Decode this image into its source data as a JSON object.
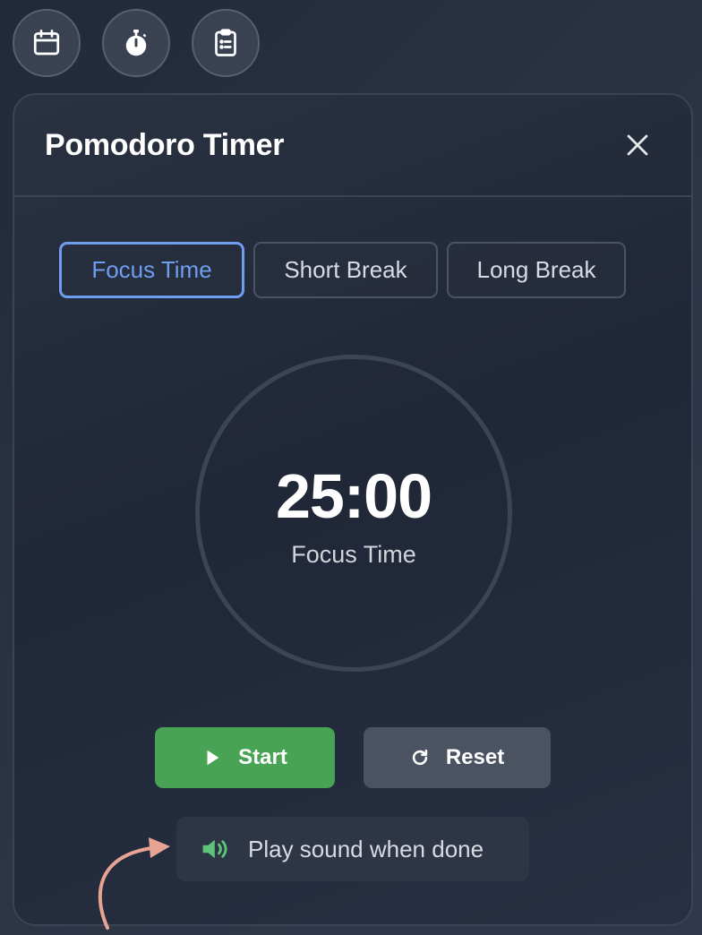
{
  "toolbar": {
    "buttons": [
      {
        "icon": "calendar-icon"
      },
      {
        "icon": "stopwatch-icon"
      },
      {
        "icon": "clipboard-list-icon"
      }
    ]
  },
  "modal": {
    "title": "Pomodoro Timer",
    "close_icon": "close-icon"
  },
  "modes": {
    "focus_label": "Focus Time",
    "short_label": "Short Break",
    "long_label": "Long Break",
    "active": "Focus Time"
  },
  "timer": {
    "time": "25:00",
    "label": "Focus Time"
  },
  "controls": {
    "start_label": "Start",
    "reset_label": "Reset"
  },
  "sound": {
    "label": "Play sound when done",
    "icon": "speaker-icon",
    "icon_color": "#5fc27a"
  },
  "colors": {
    "accent": "#6f9ef0",
    "start": "#48a354",
    "reset": "#4b5362",
    "annotation_arrow": "#e8a493"
  }
}
